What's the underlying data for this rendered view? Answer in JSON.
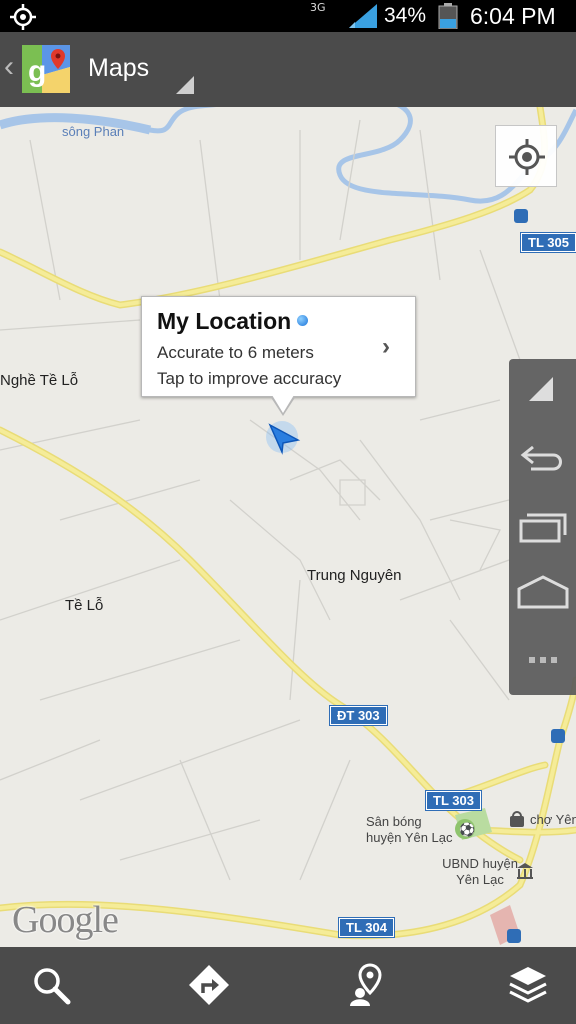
{
  "status_bar": {
    "network": "3G",
    "battery_percent": "34%",
    "time": "6:04 PM",
    "icons": [
      "gps-icon",
      "signal-icon",
      "battery-icon"
    ]
  },
  "action_bar": {
    "title": "Maps",
    "icons": [
      "back-icon",
      "maps-logo-icon",
      "dropdown-icon"
    ]
  },
  "map": {
    "labels": {
      "river": "sông Phan",
      "place1": "Nghề Tề Lỗ",
      "place2": "Tề Lỗ",
      "place3": "Trung Nguyên",
      "stadium": "Sân bóng huyện Yên Lạc",
      "ubnd": "UBND huyện Yên Lạc",
      "market": "chợ Yên"
    },
    "roads": [
      "TL 305",
      "ĐT 303",
      "TL 303",
      "TL 304"
    ],
    "attribution": "Google"
  },
  "info_bubble": {
    "title": "My Location",
    "line1": "Accurate to 6 meters",
    "line2": "Tap to improve accuracy"
  },
  "nav_panel": {
    "icons": [
      "menu-corner-icon",
      "back-icon",
      "recent-apps-icon",
      "home-icon",
      "more-icon"
    ]
  },
  "bottom_bar": {
    "icons": [
      "search-icon",
      "directions-icon",
      "places-icon",
      "layers-icon"
    ]
  },
  "colors": {
    "map_bg": "#ecebe6",
    "road": "#f5ec98",
    "river": "#a7c5e8",
    "bar": "#4b4b4b",
    "shield": "#2f6db6"
  }
}
